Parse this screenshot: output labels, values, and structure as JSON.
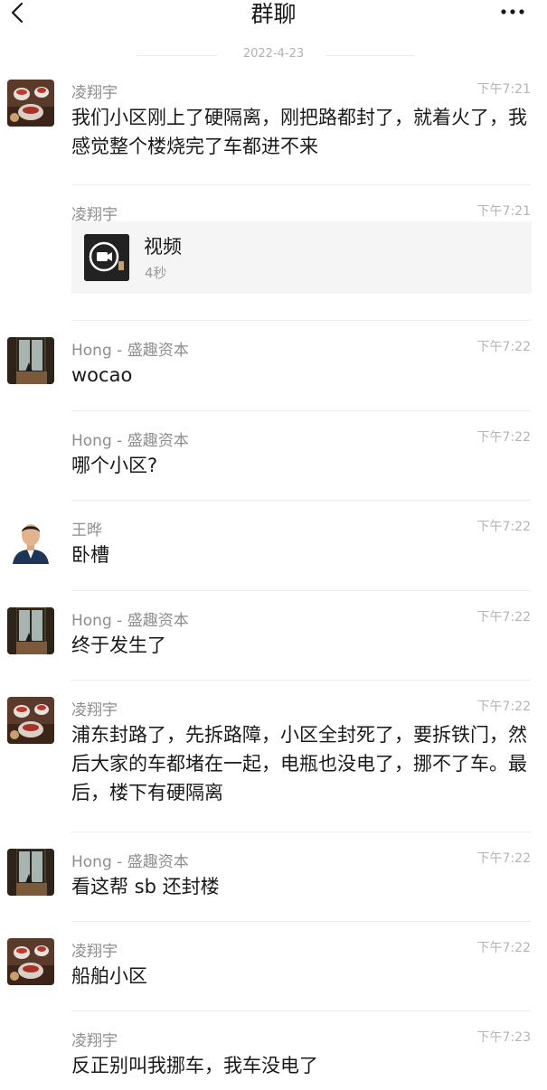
{
  "header": {
    "title": "群聊",
    "back_icon": "chevron-left-icon",
    "more_icon": "more-dots-icon"
  },
  "date_separator": "2022-4-23",
  "messages": [
    {
      "sender": "凌翔宇",
      "time": "下午7:21",
      "text": "我们小区刚上了硬隔离，刚把路都封了，就着火了，我感觉整个楼烧完了车都进不来"
    },
    {
      "sender": "凌翔宇",
      "time": "下午7:21",
      "video": {
        "title": "视频",
        "duration": "4秒"
      }
    },
    {
      "sender": "Hong - 盛趣资本",
      "time": "下午7:22",
      "text": "wocao"
    },
    {
      "sender": "Hong - 盛趣资本",
      "time": "下午7:22",
      "text": "哪个小区?"
    },
    {
      "sender": "王晔",
      "time": "下午7:22",
      "text": "卧槽"
    },
    {
      "sender": "Hong - 盛趣资本",
      "time": "下午7:22",
      "text": "终于发生了"
    },
    {
      "sender": "凌翔宇",
      "time": "下午7:22",
      "text": "浦东封路了，先拆路障，小区全封死了，要拆铁门，然后大家的车都堵在一起，电瓶也没电了，挪不了车。最后，楼下有硬隔离"
    },
    {
      "sender": "Hong - 盛趣资本",
      "time": "下午7:22",
      "text": "看这帮 sb 还封楼"
    },
    {
      "sender": "凌翔宇",
      "time": "下午7:22",
      "text": "船舶小区"
    },
    {
      "sender": "凌翔宇",
      "time": "下午7:23",
      "text": "反正别叫我挪车，我车没电了"
    }
  ]
}
